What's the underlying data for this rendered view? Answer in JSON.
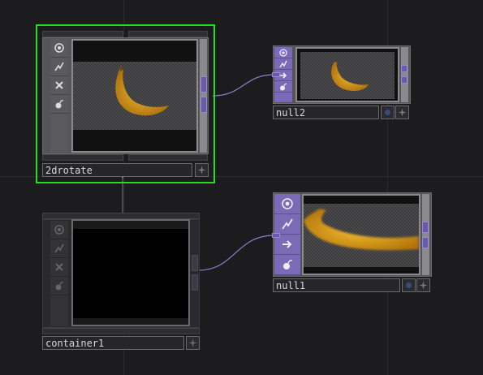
{
  "network": {
    "nodes": [
      {
        "label": "2drotate",
        "selected": true
      },
      {
        "label": "null2",
        "selected": false
      },
      {
        "label": "container1",
        "selected": false
      },
      {
        "label": "null1",
        "selected": false
      }
    ]
  },
  "colors": {
    "background": "#1c1c1e",
    "selection": "#22dd22",
    "sidebar_purple": "#7a6bb8",
    "sidebar_gray": "#5a5a5e",
    "wire": "#8f7fd0",
    "banana": "#e8a818"
  },
  "icons": {
    "viewer": "viewer-icon",
    "cook": "cook-icon",
    "bypass": "bypass-icon",
    "display": "display-icon",
    "lock": "lock-icon",
    "compass": "compass-icon"
  }
}
